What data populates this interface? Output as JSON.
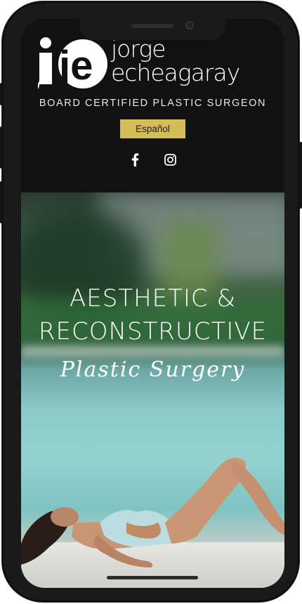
{
  "brand": {
    "monogram": "je",
    "name_line1": "jorge",
    "name_line2": "echeagaray",
    "tagline": "BOARD CERTIFIED PLASTIC SURGEON"
  },
  "language_button": "Español",
  "social": [
    {
      "icon": "facebook-icon",
      "glyph": "f"
    },
    {
      "icon": "instagram-icon"
    }
  ],
  "hero": {
    "line1": "AESTHETIC &",
    "line2": "RECONSTRUCTIVE",
    "script": "Plastic Surgery"
  },
  "colors": {
    "accent": "#d4bd58",
    "header_bg": "#111111"
  }
}
